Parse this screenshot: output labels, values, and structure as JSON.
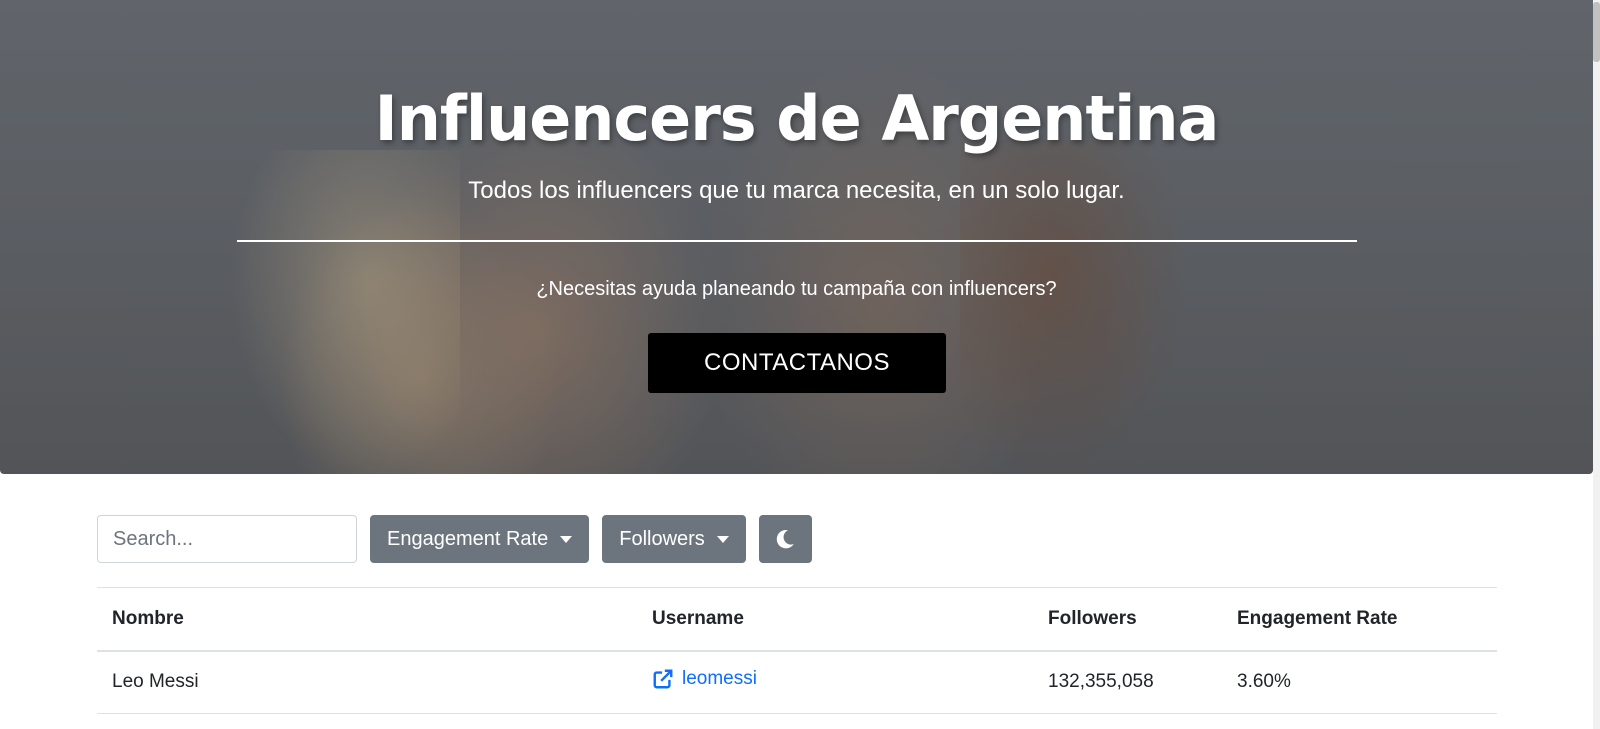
{
  "hero": {
    "title": "Influencers de Argentina",
    "subtitle": "Todos los influencers que tu marca necesita, en un solo lugar.",
    "question": "¿Necesitas ayuda planeando tu campaña con influencers?",
    "cta_label": "CONTACTANOS"
  },
  "toolbar": {
    "search_placeholder": "Search...",
    "engagement_label": "Engagement Rate",
    "followers_label": "Followers",
    "theme_icon": "moon-icon"
  },
  "table": {
    "headers": [
      "Nombre",
      "Username",
      "Followers",
      "Engagement Rate"
    ],
    "rows": [
      {
        "name": "Leo Messi",
        "username": "leomessi",
        "followers": "132,355,058",
        "engagement": "3.60%"
      }
    ]
  },
  "colors": {
    "link": "#0d6efd",
    "button_gray": "#6c757d",
    "cta_bg": "#000000"
  }
}
